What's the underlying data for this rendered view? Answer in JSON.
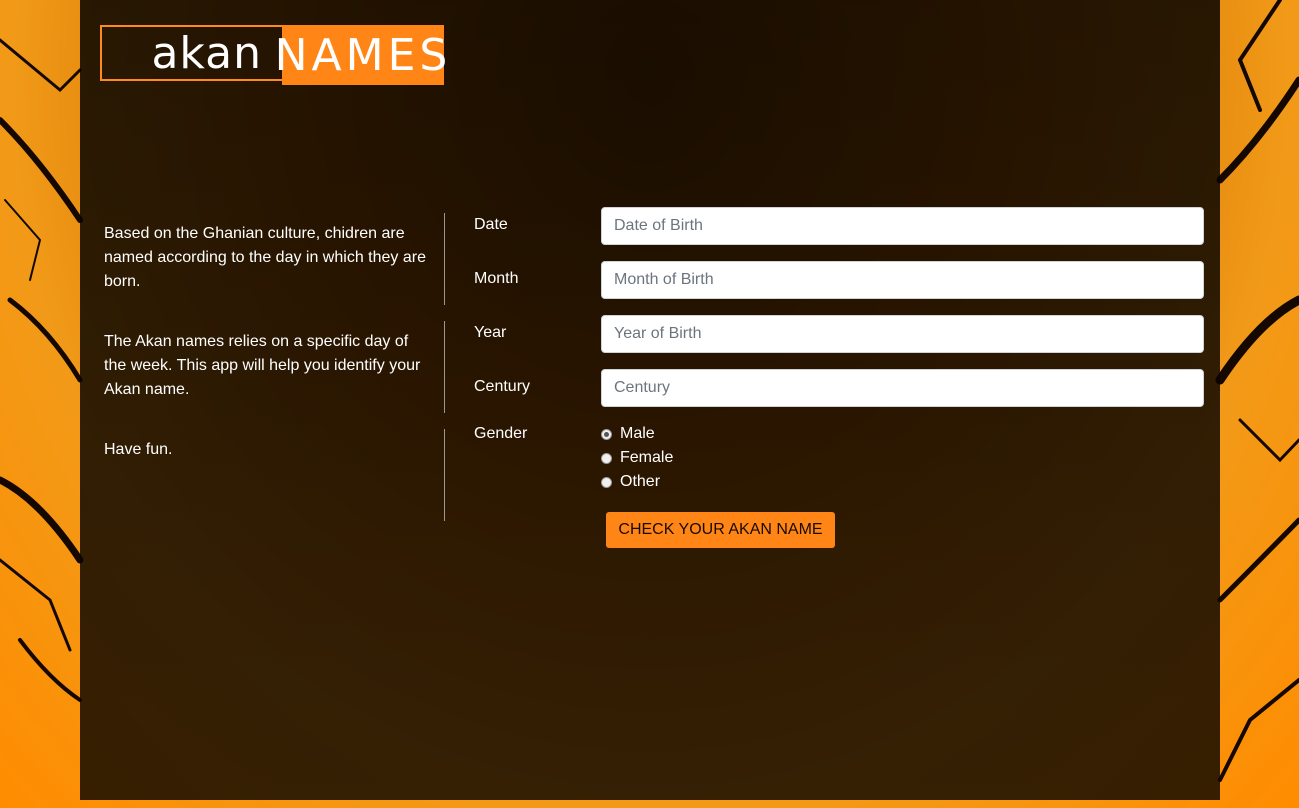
{
  "logo": {
    "left_text": "akan",
    "right_text": "NAMES"
  },
  "info": {
    "paragraphs": [
      "Based on the Ghanian culture, chidren are named according to the day in which they are born.",
      "The Akan names relies on a specific day of the week. This app will help you identify your Akan name.",
      "Have fun."
    ]
  },
  "form": {
    "date": {
      "label": "Date",
      "placeholder": "Date of Birth"
    },
    "month": {
      "label": "Month",
      "placeholder": "Month of Birth"
    },
    "year": {
      "label": "Year",
      "placeholder": "Year of Birth"
    },
    "century": {
      "label": "Century",
      "placeholder": "Century"
    },
    "gender": {
      "label": "Gender",
      "options": [
        "Male",
        "Female",
        "Other"
      ],
      "selected": "Male"
    },
    "submit_label": "CHECK YOUR AKAN NAME"
  },
  "colors": {
    "accent": "#ff8616",
    "panel": "#080400"
  }
}
